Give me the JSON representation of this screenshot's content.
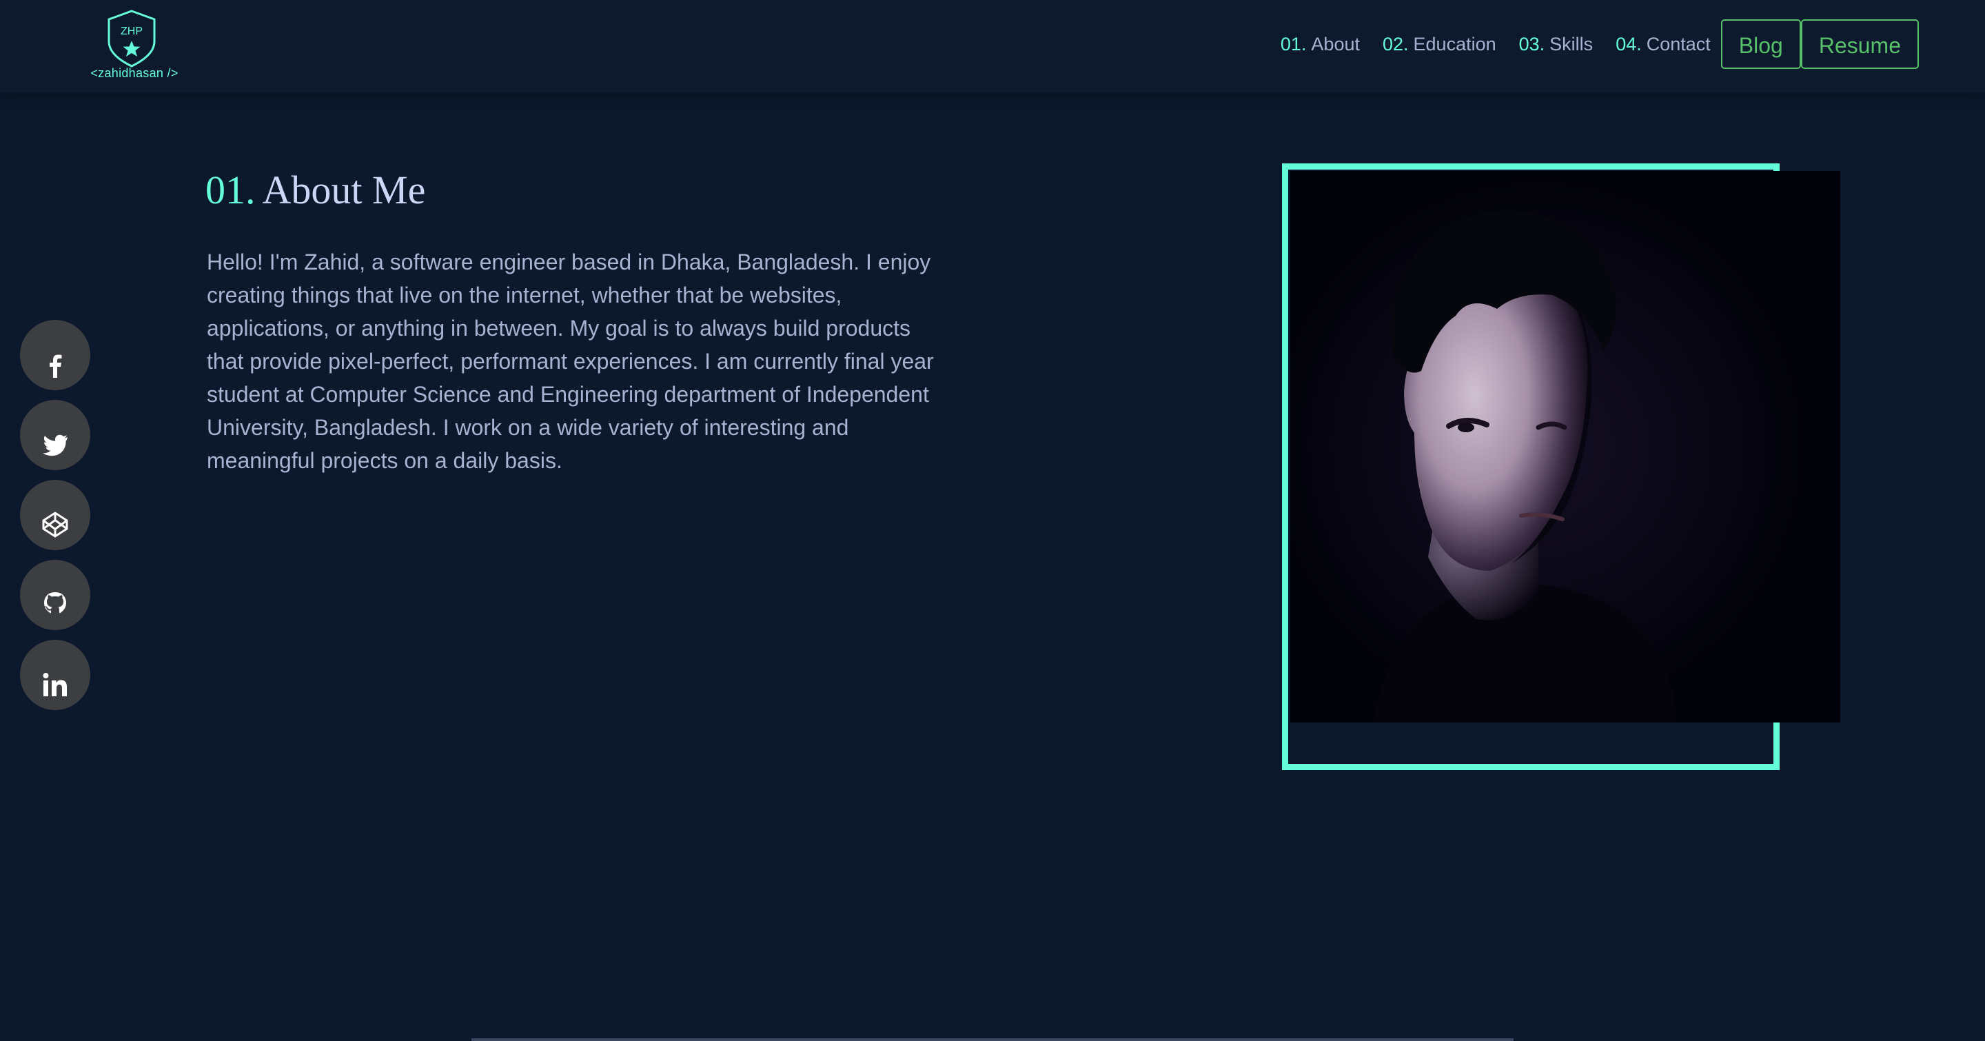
{
  "logo": {
    "initials": "ZHP",
    "text": "<zahidhasan />"
  },
  "nav": {
    "items": [
      {
        "num": "01.",
        "label": "About"
      },
      {
        "num": "02.",
        "label": "Education"
      },
      {
        "num": "03.",
        "label": "Skills"
      },
      {
        "num": "04.",
        "label": "Contact"
      }
    ],
    "blog_label": "Blog",
    "resume_label": "Resume"
  },
  "social": [
    "facebook-icon",
    "twitter-icon",
    "codepen-icon",
    "github-icon",
    "linkedin-icon"
  ],
  "about": {
    "num": "01.",
    "title": "About Me",
    "bio": "Hello! I'm Zahid, a software engineer based in Dhaka, Bangladesh. I enjoy creating things that live on the internet, whether that be websites, applications, or anything in between. My goal is to always build products that provide pixel-perfect, performant experiences. I am currently final year student at Computer Science and Engineering department of Independent University, Bangladesh. I work on a wide variety of interesting and meaningful projects on a daily basis."
  },
  "colors": {
    "background": "#0c182c",
    "accent": "#64ffda",
    "button": "#58c06a",
    "text": "#a8b2d1",
    "heading": "#ccd6f6",
    "social_bg": "#3d3e42"
  }
}
